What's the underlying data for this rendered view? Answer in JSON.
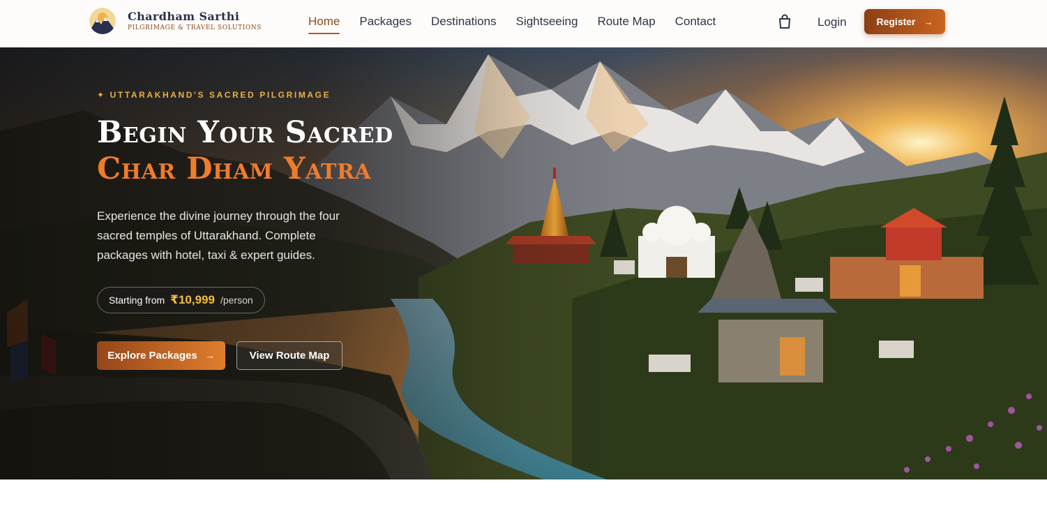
{
  "brand": {
    "name": "Chardham Sarthi",
    "tagline": "Pilgrimage & Travel Solutions"
  },
  "nav": {
    "items": [
      {
        "label": "Home",
        "active": true
      },
      {
        "label": "Packages"
      },
      {
        "label": "Destinations"
      },
      {
        "label": "Sightseeing"
      },
      {
        "label": "Route Map"
      },
      {
        "label": "Contact"
      }
    ],
    "cart_icon": "shopping-bag-icon",
    "login_label": "Login",
    "register_label": "Register"
  },
  "hero": {
    "eyebrow": "UTTARAKHAND'S SACRED PILGRIMAGE",
    "eyebrow_icon": "✦",
    "title_line1": "Begin Your Sacred",
    "title_line2": "Char Dham Yatra",
    "description": "Experience the divine journey through the four sacred temples of Uttarakhand. Complete packages with hotel, taxi & expert guides.",
    "price_prefix": "Starting from",
    "price": "₹10,999",
    "price_unit": "/person",
    "primary_button": "Explore Packages",
    "secondary_button": "View Route Map"
  },
  "colors": {
    "accent": "#b35a1f",
    "brand_navy": "#2a2f4d",
    "title_orange": "#ef7c2c",
    "price_gold": "#f5bf3c"
  }
}
